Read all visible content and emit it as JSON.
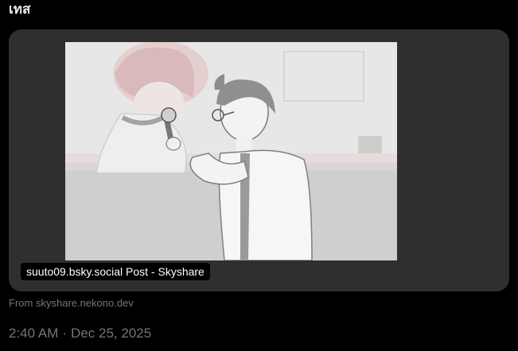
{
  "post": {
    "text": "เทส"
  },
  "link_card": {
    "title": "suuto09.bsky.social Post - Skyshare",
    "image_description": "manga-style illustration"
  },
  "source": {
    "label": "From skyshare.nekono.dev"
  },
  "meta": {
    "time": "2:40 AM",
    "separator": "·",
    "date": "Dec 25, 2025"
  },
  "colors": {
    "background": "#000000",
    "card": "#2f2f2f",
    "text_primary": "#e7e9ea",
    "text_secondary": "#71767b"
  }
}
